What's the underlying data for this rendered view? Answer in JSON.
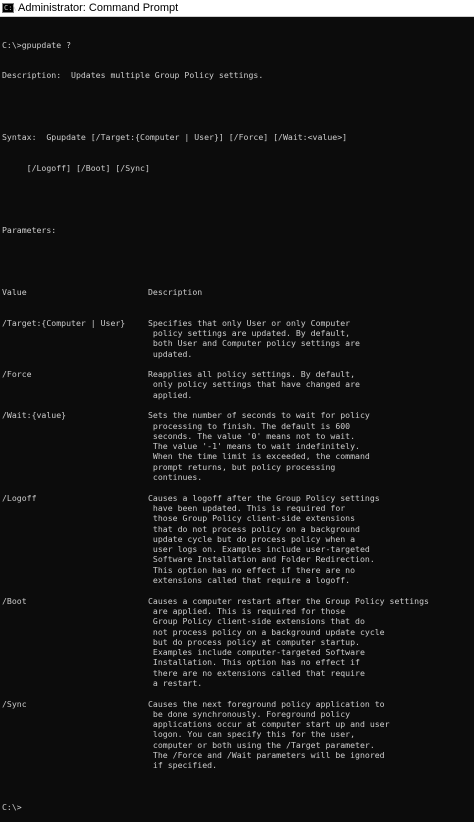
{
  "window": {
    "title": "Administrator: Command Prompt",
    "icon": "cmd-icon"
  },
  "console": {
    "command": "C:\\>gpupdate ?",
    "description": "Description:  Updates multiple Group Policy settings.",
    "syntax_1": "Syntax:  Gpupdate [/Target:{Computer | User}] [/Force] [/Wait:<value>]",
    "syntax_2": "     [/Logoff] [/Boot] [/Sync]",
    "parameters_heading": "Parameters:",
    "header": {
      "value": "Value",
      "description": "Description"
    },
    "params": [
      {
        "name": "/Target:{Computer | User}",
        "lines": [
          "Specifies that only User or only Computer",
          " policy settings are updated. By default,",
          " both User and Computer policy settings are",
          " updated."
        ]
      },
      {
        "name": "/Force",
        "lines": [
          "Reapplies all policy settings. By default,",
          " only policy settings that have changed are",
          " applied."
        ]
      },
      {
        "name": "/Wait:{value}",
        "lines": [
          "Sets the number of seconds to wait for policy",
          " processing to finish. The default is 600",
          " seconds. The value '0' means not to wait.",
          " The value '-1' means to wait indefinitely.",
          " When the time limit is exceeded, the command",
          " prompt returns, but policy processing",
          " continues."
        ]
      },
      {
        "name": "/Logoff",
        "lines": [
          "Causes a logoff after the Group Policy settings",
          " have been updated. This is required for",
          " those Group Policy client-side extensions",
          " that do not process policy on a background",
          " update cycle but do process policy when a",
          " user logs on. Examples include user-targeted",
          " Software Installation and Folder Redirection.",
          " This option has no effect if there are no",
          " extensions called that require a logoff."
        ]
      },
      {
        "name": "/Boot",
        "lines": [
          "Causes a computer restart after the Group Policy settings",
          " are applied. This is required for those",
          " Group Policy client-side extensions that do",
          " not process policy on a background update cycle",
          " but do process policy at computer startup.",
          " Examples include computer-targeted Software",
          " Installation. This option has no effect if",
          " there are no extensions called that require",
          " a restart."
        ]
      },
      {
        "name": "/Sync",
        "lines": [
          "Causes the next foreground policy application to",
          " be done synchronously. Foreground policy",
          " applications occur at computer start up and user",
          " logon. You can specify this for the user,",
          " computer or both using the /Target parameter.",
          " The /Force and /Wait parameters will be ignored",
          " if specified."
        ]
      }
    ],
    "prompt": "C:\\>"
  },
  "colors": {
    "background": "#0c0c0c",
    "text": "#cccccc",
    "titlebar": "#ffffff"
  }
}
